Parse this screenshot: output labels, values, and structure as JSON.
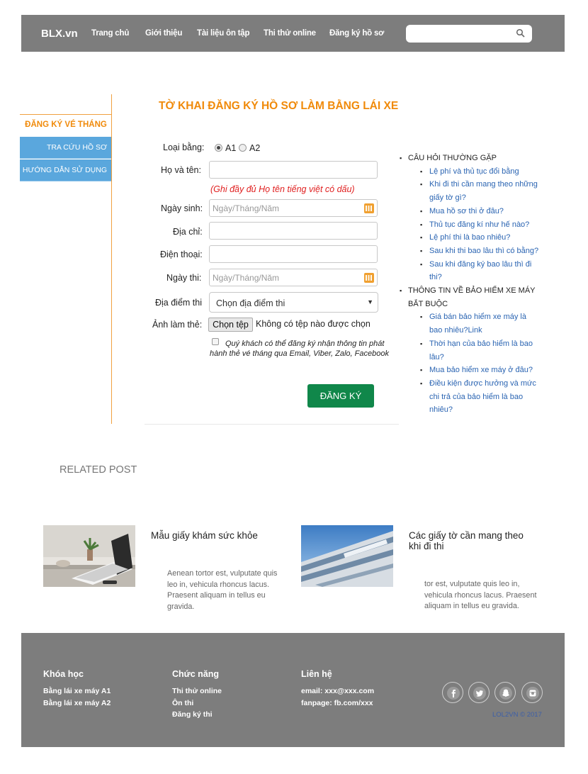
{
  "header": {
    "logo": "BLX.vn",
    "nav": [
      "Trang chủ",
      "Giới thiệu",
      "Tài liệu ôn tập",
      "Thi thử online",
      "Đăng ký hồ sơ"
    ],
    "search_placeholder": "",
    "search_icon": "search-icon"
  },
  "sidebar": {
    "title": "ĐĂNG KÝ VÉ THÁNG",
    "items": [
      "TRA CỨU HỒ SƠ",
      "HƯỚNG DẪN SỬ DỤNG"
    ]
  },
  "form": {
    "title": "TỜ KHAI ĐĂNG KÝ HỒ SƠ LÀM BẰNG LÁI XE",
    "license_label": "Loại bằng:",
    "license_options": [
      "A1",
      "A2"
    ],
    "license_selected": "A1",
    "name_label": "Họ và tên:",
    "name_value": "",
    "name_note": "(Ghi đầy đủ Họ tên tiếng việt có dấu)",
    "dob_label": "Ngày sinh:",
    "dob_placeholder": "Ngày/Tháng/Năm",
    "address_label": "Địa chỉ:",
    "address_value": "",
    "phone_label": "Điện thoại:",
    "phone_value": "",
    "exam_date_label": "Ngày thi:",
    "exam_date_placeholder": "Ngày/Tháng/Năm",
    "location_label": "Địa điểm thi",
    "location_selected": "Chọn địa điểm thi",
    "photo_label": "Ảnh làm thẻ:",
    "file_button": "Chọn tệp",
    "file_status": "Không có tệp nào được chọn",
    "consent_checked": false,
    "consent_text": "Quý khách có thể đăng ký nhận thông tin phát hành thẻ vé tháng qua Email, Viber, Zalo, Facebook",
    "submit": "ĐĂNG KÝ",
    "submit_color": "#10874a"
  },
  "faq": [
    {
      "group": "CÂU HỎI THƯỜNG GẶP",
      "links": [
        "Lệ phí và thủ tục đổi bằng",
        "Khi đi thi cần mang theo những giấy tờ gì?",
        "Mua hồ sơ thi ở đâu?",
        "Thủ tục đăng kí như hế nào?",
        "Lệ phí thi là bao nhiêu?",
        "Sau khi thi bao lâu thì có bằng?",
        "Sau khi đăng ký bao lâu thì đi thi?"
      ]
    },
    {
      "group": "THÔNG TIN VỀ BẢO HIỂM XE MÁY BẮT BUỘC",
      "links": [
        "Giá bán bảo hiểm xe máy là bao nhiêu?Link",
        "Thời hạn của bảo hiểm là bao lâu?",
        "Mua bảo hiểm xe máy ở đâu?",
        "Điều kiện được hưởng và mức chi trả của bảo hiểm là bao nhiêu?"
      ]
    }
  ],
  "related": {
    "heading": "RELATED POST",
    "posts": [
      {
        "title": "Mẫu giấy khám sức khỏe",
        "excerpt": "Aenean tortor est, vulputate quis leo in, vehicula rhoncus lacus. Praesent aliquam in tellus eu gravida."
      },
      {
        "title": "Các giấy tờ cần mang theo khi đi thi",
        "excerpt": "tor est, vulputate quis leo in, vehicula rhoncus lacus. Praesent aliquam in tellus eu gravida."
      }
    ]
  },
  "footer": {
    "columns": [
      {
        "heading": "Khóa học",
        "items": [
          "Bằng lái xe máy A1",
          "Bằng lái xe máy A2"
        ]
      },
      {
        "heading": "Chức năng",
        "items": [
          "Thi thử online",
          "Ôn thi",
          "Đăng ký thi"
        ]
      },
      {
        "heading": "Liên hệ",
        "items": [
          "email: xxx@xxx.com",
          "fanpage: fb.com/xxx"
        ]
      }
    ],
    "social": [
      "facebook-icon",
      "twitter-icon",
      "snapchat-icon",
      "instagram-icon"
    ],
    "copyright": "LOL2VN © 2017"
  },
  "colors": {
    "header_bg": "#7d7d7d",
    "accent_orange": "#f08a0a",
    "sidebar_blue": "#5aa7dd",
    "link_blue": "#2a64b2"
  }
}
